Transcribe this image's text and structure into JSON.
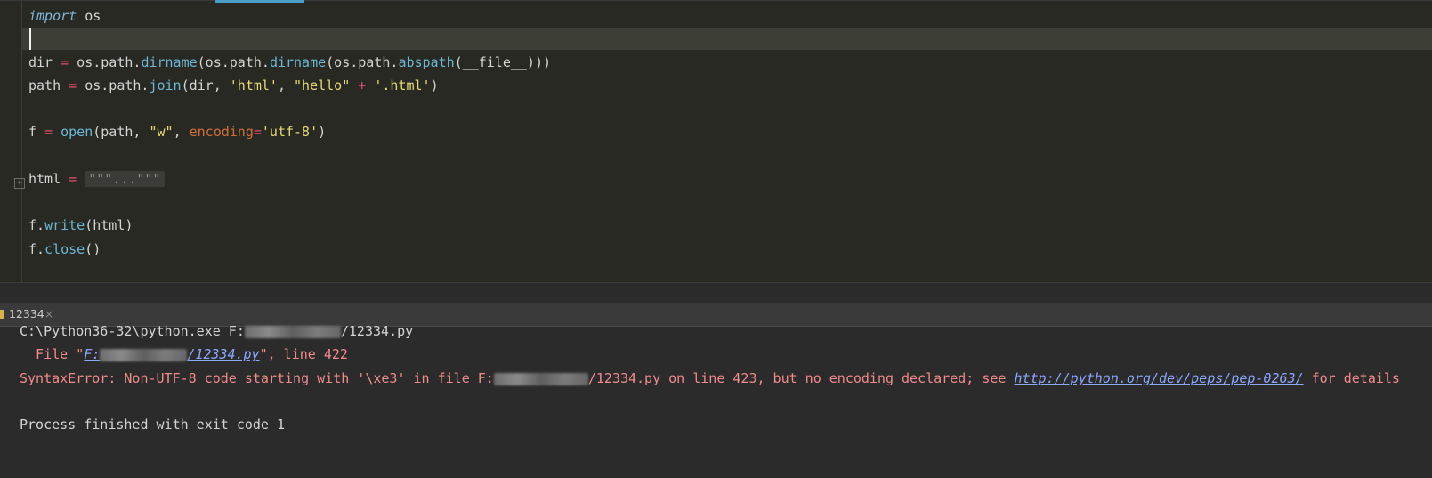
{
  "editor": {
    "lines": [
      {
        "parts": [
          {
            "t": "import",
            "c": "kw"
          },
          {
            "t": " os",
            "c": ""
          }
        ]
      },
      {
        "parts": []
      },
      {
        "parts": [
          {
            "t": "dir ",
            "c": ""
          },
          {
            "t": "=",
            "c": "op"
          },
          {
            "t": " os.path.",
            "c": ""
          },
          {
            "t": "dirname",
            "c": "fn"
          },
          {
            "t": "(os.path.",
            "c": ""
          },
          {
            "t": "dirname",
            "c": "fn"
          },
          {
            "t": "(os.path.",
            "c": ""
          },
          {
            "t": "abspath",
            "c": "fn"
          },
          {
            "t": "(__file__)))",
            "c": ""
          }
        ]
      },
      {
        "parts": [
          {
            "t": "path ",
            "c": ""
          },
          {
            "t": "=",
            "c": "op"
          },
          {
            "t": " os.path.",
            "c": ""
          },
          {
            "t": "join",
            "c": "fn"
          },
          {
            "t": "(dir, ",
            "c": ""
          },
          {
            "t": "'html'",
            "c": "str"
          },
          {
            "t": ", ",
            "c": ""
          },
          {
            "t": "\"hello\"",
            "c": "str"
          },
          {
            "t": " + ",
            "c": "op"
          },
          {
            "t": "'.html'",
            "c": "str"
          },
          {
            "t": ")",
            "c": ""
          }
        ]
      },
      {
        "parts": []
      },
      {
        "parts": [
          {
            "t": "f ",
            "c": ""
          },
          {
            "t": "=",
            "c": "op"
          },
          {
            "t": " ",
            "c": ""
          },
          {
            "t": "open",
            "c": "fn"
          },
          {
            "t": "(path, ",
            "c": ""
          },
          {
            "t": "\"w\"",
            "c": "str"
          },
          {
            "t": ", ",
            "c": ""
          },
          {
            "t": "encoding",
            "c": "param"
          },
          {
            "t": "=",
            "c": "op"
          },
          {
            "t": "'utf-8'",
            "c": "str"
          },
          {
            "t": ")",
            "c": ""
          }
        ]
      },
      {
        "parts": []
      },
      {
        "parts": [
          {
            "t": "html ",
            "c": ""
          },
          {
            "t": "=",
            "c": "op"
          },
          {
            "t": " ",
            "c": ""
          },
          {
            "t": "\"\"\"...\"\"\"",
            "c": "folded"
          }
        ]
      },
      {
        "parts": []
      },
      {
        "parts": [
          {
            "t": "f.",
            "c": ""
          },
          {
            "t": "write",
            "c": "fn"
          },
          {
            "t": "(html)",
            "c": ""
          }
        ]
      },
      {
        "parts": [
          {
            "t": "f.",
            "c": ""
          },
          {
            "t": "close",
            "c": "fn"
          },
          {
            "t": "()",
            "c": ""
          }
        ]
      }
    ]
  },
  "run_panel": {
    "tab_label": "12334",
    "close_glyph": "×"
  },
  "console": {
    "line1_prefix": "C:\\Python36-32\\python.exe F:",
    "line1_suffix": "/12334.py",
    "line2_prefix": "  File \"",
    "line2_link_a": "F:",
    "line2_link_b": "/12334.py",
    "line2_suffix": "\", line 422",
    "line3_prefix": "SyntaxError: Non-UTF-8 code starting with '\\xe3' in file F:",
    "line3_mid": "/12334.py on line 423, but no encoding declared; see ",
    "line3_link": "http://python.org/dev/peps/pep-0263/",
    "line3_suffix": " for details",
    "line5": "Process finished with exit code 1"
  }
}
